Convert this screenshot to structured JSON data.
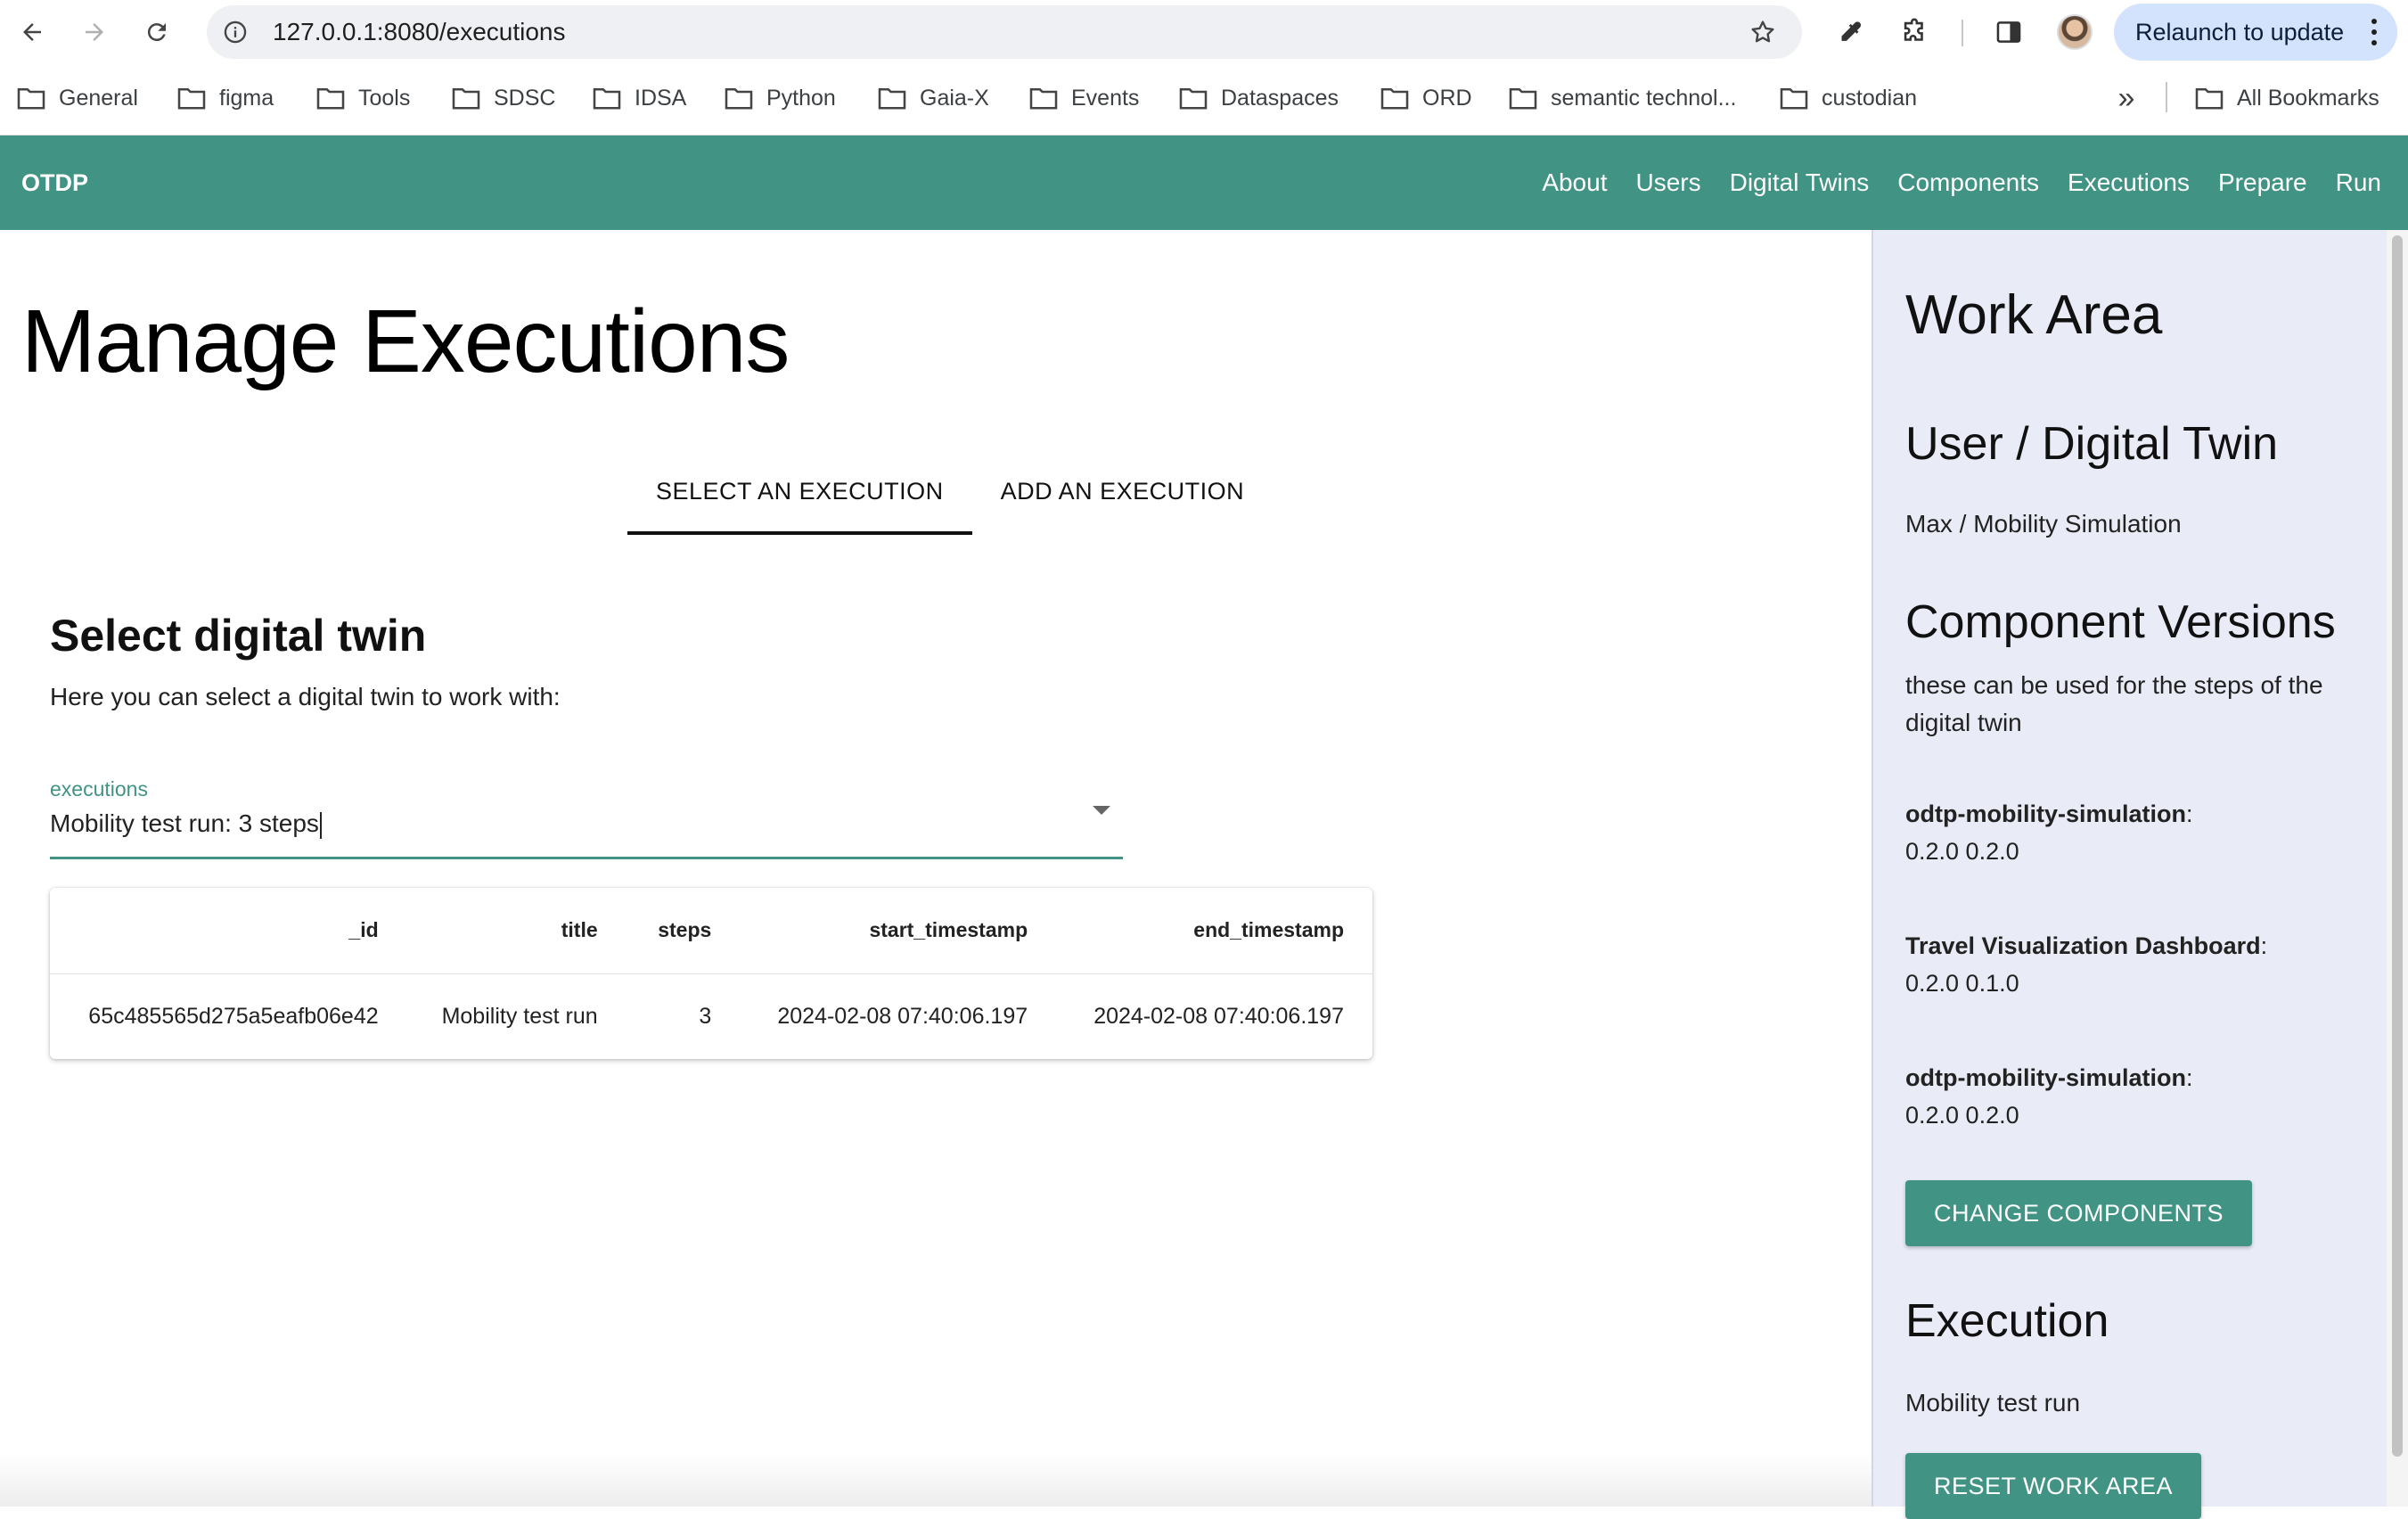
{
  "browser": {
    "url": "127.0.0.1:8080/executions",
    "relaunch_label": "Relaunch to update",
    "bookmarks": [
      "General",
      "figma",
      "Tools",
      "SDSC",
      "IDSA",
      "Python",
      "Gaia-X",
      "Events",
      "Dataspaces",
      "ORD",
      "semantic technol...",
      "custodian"
    ],
    "all_bookmarks_label": "All Bookmarks"
  },
  "appbar": {
    "brand": "OTDP",
    "nav": [
      "About",
      "Users",
      "Digital Twins",
      "Components",
      "Executions",
      "Prepare",
      "Run"
    ]
  },
  "main": {
    "title": "Manage Executions",
    "tabs": [
      {
        "label": "SELECT AN EXECUTION",
        "active": true
      },
      {
        "label": "ADD AN EXECUTION",
        "active": false
      }
    ],
    "section_title": "Select digital twin",
    "section_sub": "Here you can select a digital twin to work with:",
    "select": {
      "label": "executions",
      "value": "Mobility test run: 3 steps"
    },
    "table": {
      "columns": [
        "_id",
        "title",
        "steps",
        "start_timestamp",
        "end_timestamp"
      ],
      "rows": [
        [
          "65c485565d275a5eafb06e42",
          "Mobility test run",
          "3",
          "2024-02-08 07:40:06.197",
          "2024-02-08 07:40:06.197"
        ]
      ]
    }
  },
  "sidebar": {
    "title": "Work Area",
    "user_heading": "User / Digital Twin",
    "user_value": "Max / Mobility Simulation",
    "components_heading": "Component Versions",
    "components_desc": "these can be used for the steps of the digital twin",
    "components": [
      {
        "name": "odtp-mobility-simulation",
        "versions": "0.2.0 0.2.0"
      },
      {
        "name": "Travel Visualization Dashboard",
        "versions": "0.2.0 0.1.0"
      },
      {
        "name": "odtp-mobility-simulation",
        "versions": "0.2.0 0.2.0"
      }
    ],
    "change_components_label": "CHANGE COMPONENTS",
    "execution_heading": "Execution",
    "execution_value": "Mobility test run",
    "reset_label": "RESET WORK AREA"
  },
  "colors": {
    "accent": "#419384",
    "sidebar_bg": "#e9ecf7",
    "relaunch_bg": "#d3e3fd"
  }
}
